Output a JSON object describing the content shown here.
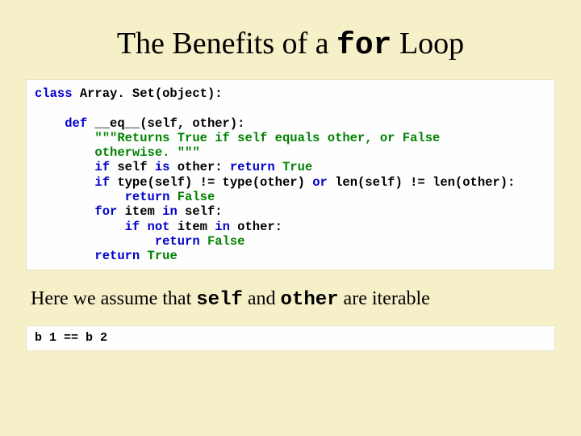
{
  "title": {
    "pre": "The Benefits of a ",
    "code": "for",
    "post": " Loop"
  },
  "code1": {
    "l0_kw": "class",
    "l0_rest": " Array. Set(object):",
    "l1_kw": "def",
    "l1_rest": " __eq__(self, other):",
    "l2_doc": "\"\"\"Returns True if self equals other, or False",
    "l3_doc": "otherwise. \"\"\"",
    "l4_a": "if",
    "l4_b": " self ",
    "l4_c": "is",
    "l4_d": " other: ",
    "l4_e": "return",
    "l4_f": " True",
    "l5_a": "if",
    "l5_b": " type(self) != type(other) ",
    "l5_c": "or",
    "l5_d": " len(self) != len(other):",
    "l6_a": "return",
    "l6_b": " False",
    "l7_a": "for",
    "l7_b": " item ",
    "l7_c": "in",
    "l7_d": " self:",
    "l8_a": "if",
    "l8_b": " ",
    "l8_c": "not",
    "l8_d": " item ",
    "l8_e": "in",
    "l8_f": " other:",
    "l9_a": "return",
    "l9_b": " False",
    "l10_a": "return",
    "l10_b": " True"
  },
  "note": {
    "a": "Here we assume that ",
    "b": "self",
    "c": " and ",
    "d": "other",
    "e": " are iterable"
  },
  "code2": {
    "text": "b 1 == b 2"
  }
}
